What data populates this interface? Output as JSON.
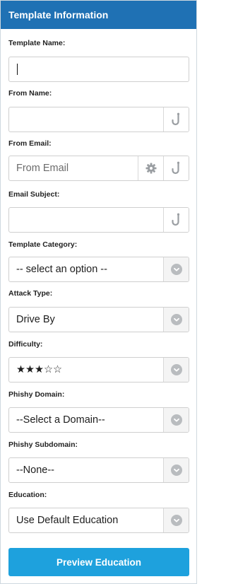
{
  "panel": {
    "title": "Template Information"
  },
  "fields": {
    "template_name": {
      "label": "Template Name:",
      "value": ""
    },
    "from_name": {
      "label": "From Name:",
      "value": ""
    },
    "from_email": {
      "label": "From Email:",
      "placeholder": "From Email"
    },
    "email_subject": {
      "label": "Email Subject:",
      "value": ""
    },
    "template_category": {
      "label": "Template Category:",
      "selected": "-- select an option --"
    },
    "attack_type": {
      "label": "Attack Type:",
      "selected": "Drive By"
    },
    "difficulty": {
      "label": "Difficulty:",
      "selected": "★★★☆☆",
      "rating": 3,
      "max": 5
    },
    "phishy_domain": {
      "label": "Phishy Domain:",
      "selected": "--Select a Domain--"
    },
    "phishy_subdomain": {
      "label": "Phishy Subdomain:",
      "selected": "--None--"
    },
    "education": {
      "label": "Education:",
      "selected": "Use Default Education"
    }
  },
  "actions": {
    "preview_label": "Preview Education"
  },
  "icons": {
    "hook": "hook-icon",
    "gear": "gear-icon",
    "chevron": "chevron-down-icon"
  },
  "colors": {
    "header_bg": "#1f71b4",
    "button_bg": "#1ea1dd",
    "icon_gray": "#9a9ea2"
  }
}
